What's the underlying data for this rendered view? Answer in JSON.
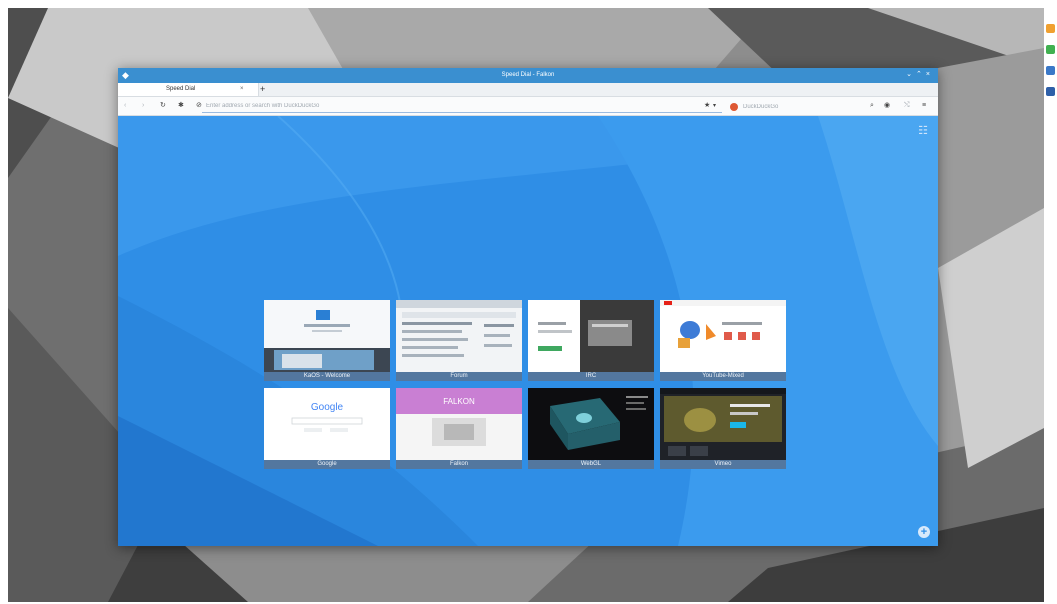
{
  "window": {
    "title": "Speed Dial - Falkon",
    "controls": [
      "minimize",
      "maximize",
      "close"
    ]
  },
  "tabs": [
    {
      "label": "Speed Dial",
      "close": "×"
    }
  ],
  "new_tab_label": "+",
  "navbar": {
    "back": "‹",
    "forward": "›",
    "reload": "↻",
    "home": "✱",
    "site_info": "⊘",
    "url_placeholder": "Enter address or search with DuckDuckGo",
    "bookmark": "★",
    "bookmark_menu": "▾",
    "search_placeholder": "DuckDuckGo",
    "search_icon": "⌕",
    "downloads": "◉",
    "tools": "⤭",
    "menu": "≡"
  },
  "speed_dial": {
    "menu": "☷",
    "add": "+",
    "items": [
      {
        "title": "KaOS - Welcome",
        "icon": "kaos-thumbnail"
      },
      {
        "title": "Forum",
        "icon": "forum-thumbnail"
      },
      {
        "title": "IRC",
        "icon": "irc-thumbnail"
      },
      {
        "title": "YouTube-Mixed",
        "icon": "youtube-thumbnail"
      },
      {
        "title": "Google",
        "icon": "google-thumbnail"
      },
      {
        "title": "Falkon",
        "icon": "falkon-thumbnail"
      },
      {
        "title": "WebGL",
        "icon": "webgl-thumbnail"
      },
      {
        "title": "Vimeo",
        "icon": "vimeo-thumbnail"
      }
    ],
    "thumbnail_text": {
      "google_logo": "Google",
      "falkon_logo": "FALKON"
    }
  },
  "colors": {
    "titlebar": "#3a8fd0",
    "content_bg": "#2f8ee6",
    "caption_bg": "#53779f",
    "desktop": "#8a8a8a"
  }
}
